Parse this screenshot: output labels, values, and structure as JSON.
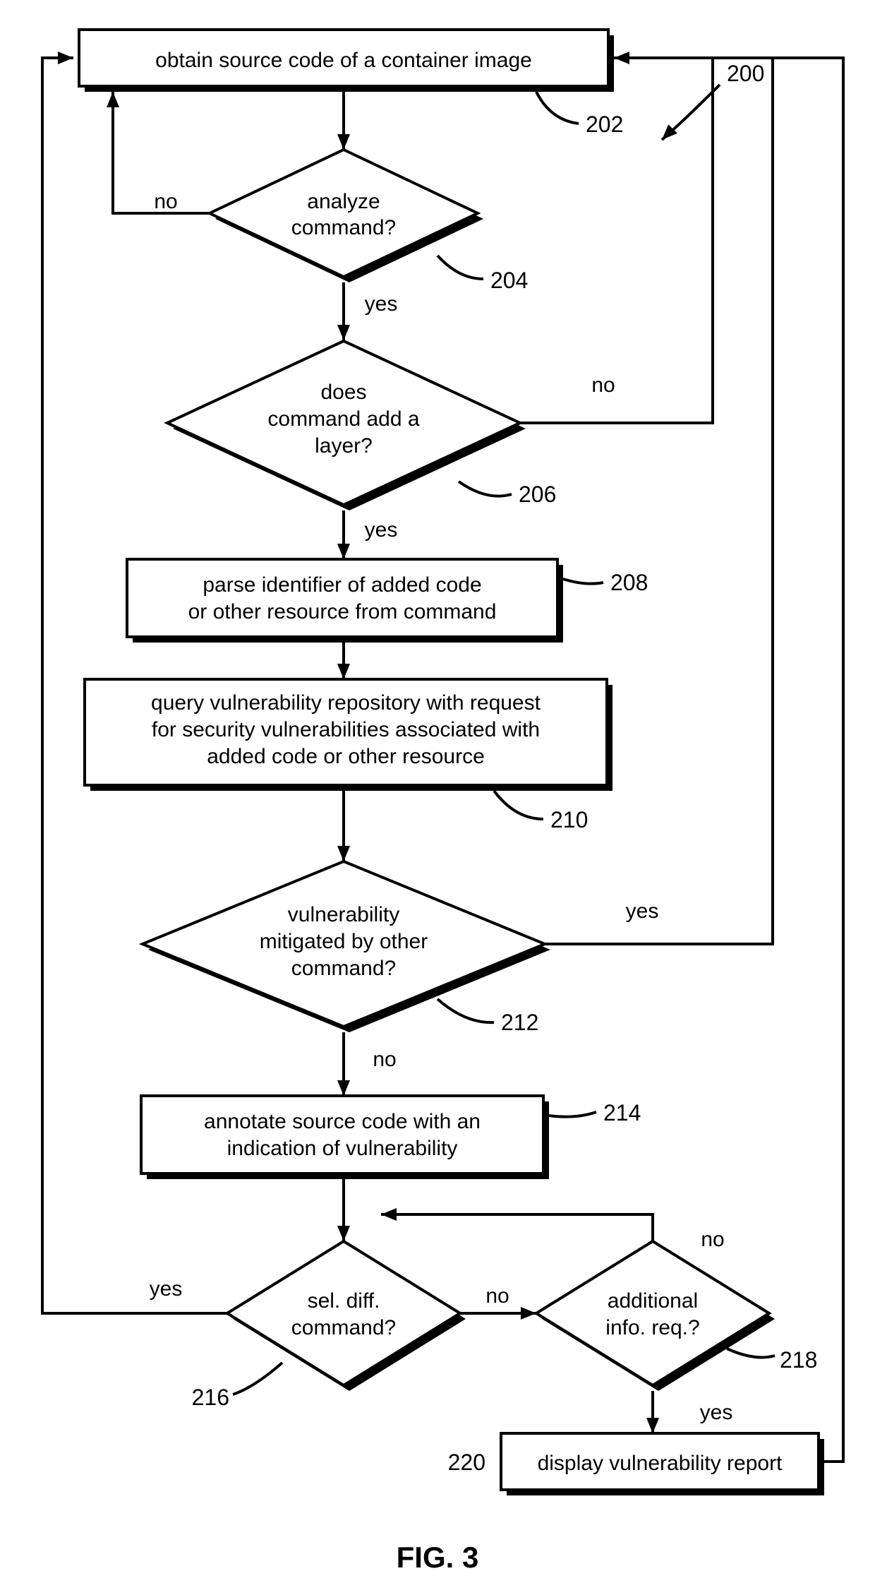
{
  "figure": "FIG. 3",
  "refs": {
    "r200": "200",
    "r202": "202",
    "r204": "204",
    "r206": "206",
    "r208": "208",
    "r210": "210",
    "r212": "212",
    "r214": "214",
    "r216": "216",
    "r218": "218",
    "r220": "220"
  },
  "nodes": {
    "n202": "obtain source code of a container image",
    "n204_l1": "analyze",
    "n204_l2": "command?",
    "n206_l1": "does",
    "n206_l2": "command add a",
    "n206_l3": "layer?",
    "n208_l1": "parse identifier of added code",
    "n208_l2": "or other resource from command",
    "n210_l1": "query vulnerability repository with request",
    "n210_l2": "for security vulnerabilities associated with",
    "n210_l3": "added code or other resource",
    "n212_l1": "vulnerability",
    "n212_l2": "mitigated by other",
    "n212_l3": "command?",
    "n214_l1": "annotate source code with an",
    "n214_l2": "indication of vulnerability",
    "n216_l1": "sel. diff.",
    "n216_l2": "command?",
    "n218_l1": "additional",
    "n218_l2": "info. req.?",
    "n220": "display vulnerability report"
  },
  "labels": {
    "yes": "yes",
    "no": "no"
  }
}
